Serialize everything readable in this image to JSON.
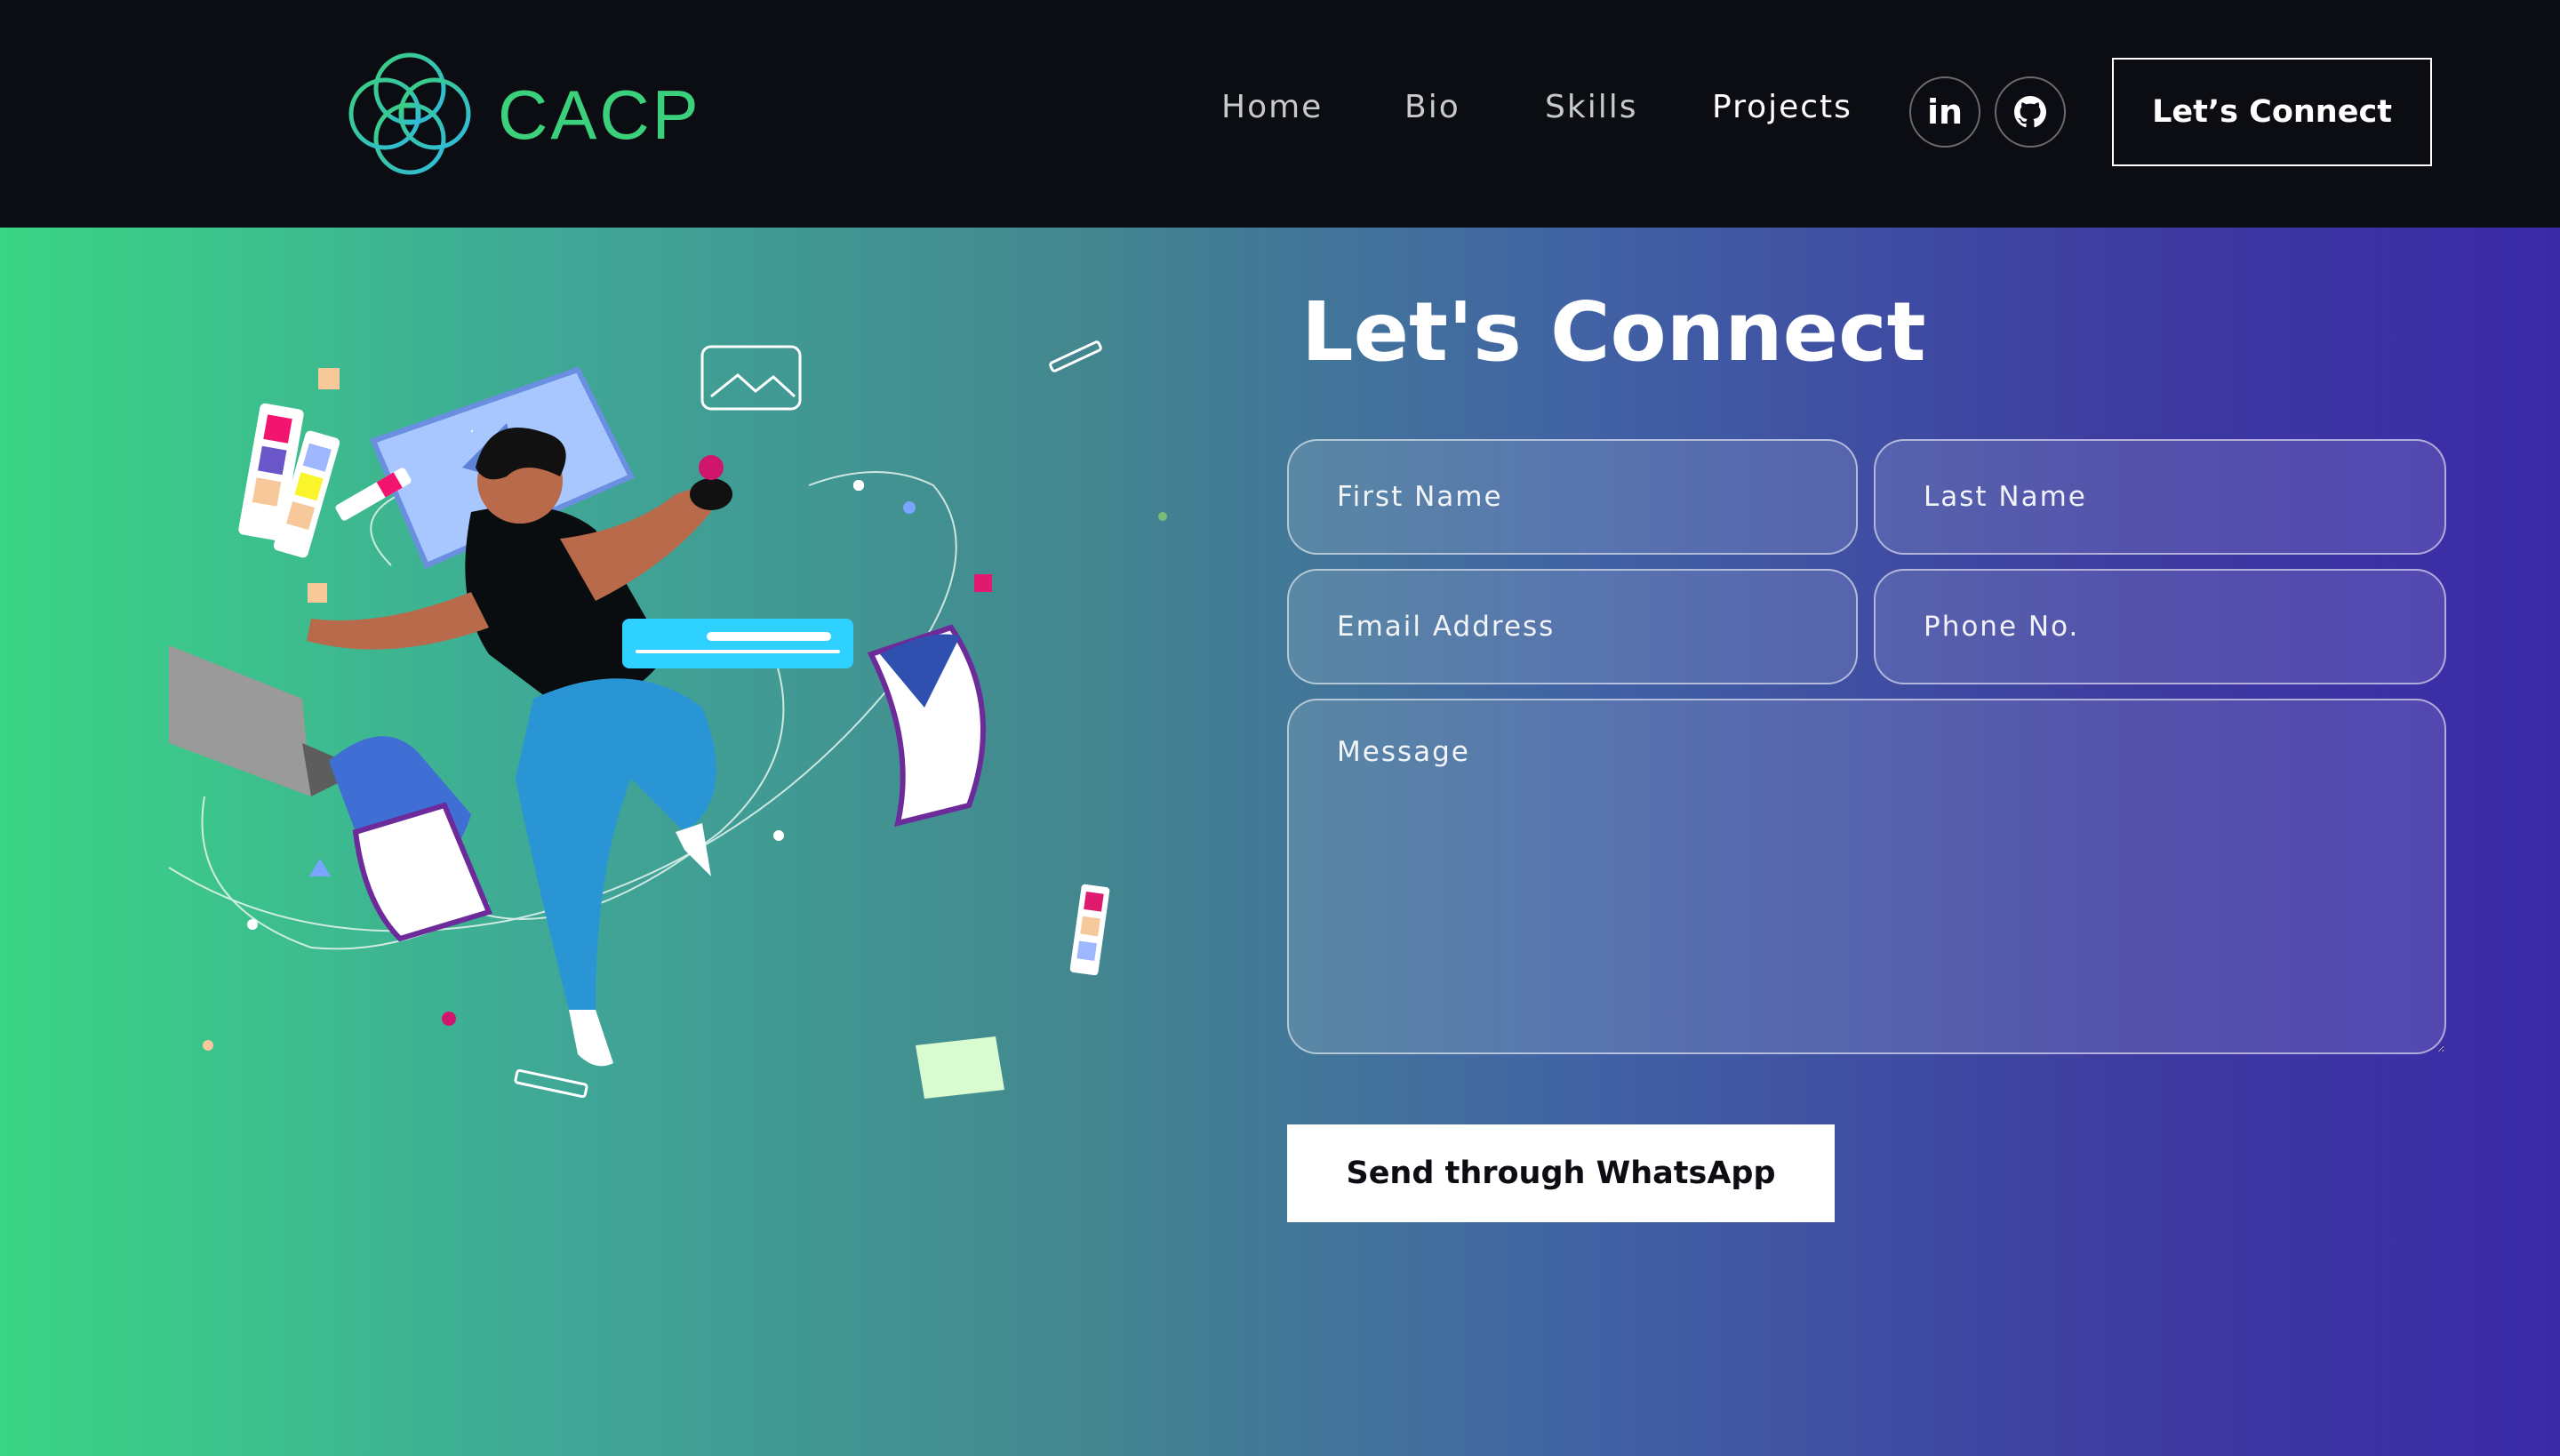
{
  "brand": {
    "name": "CACP",
    "logo_icon": "interlocking-circles-logo",
    "color": "#3bd07c"
  },
  "nav": {
    "links": [
      {
        "label": "Home"
      },
      {
        "label": "Bio"
      },
      {
        "label": "Skills"
      },
      {
        "label": "Projects"
      }
    ],
    "social": [
      {
        "icon": "linkedin-icon",
        "label": "in"
      },
      {
        "icon": "github-icon"
      }
    ],
    "cta_label": "Let’s Connect"
  },
  "contact": {
    "title": "Let's Connect",
    "fields": {
      "first_name": {
        "placeholder": "First Name",
        "value": ""
      },
      "last_name": {
        "placeholder": "Last Name",
        "value": ""
      },
      "email": {
        "placeholder": "Email Address",
        "value": ""
      },
      "phone": {
        "placeholder": "Phone No.",
        "value": ""
      },
      "message": {
        "placeholder": "Message",
        "value": ""
      }
    },
    "submit_label": "Send through WhatsApp"
  },
  "theme": {
    "nav_bg": "#0c0d12",
    "gradient_start": "#3ad585",
    "gradient_end": "#3b2aa8"
  }
}
